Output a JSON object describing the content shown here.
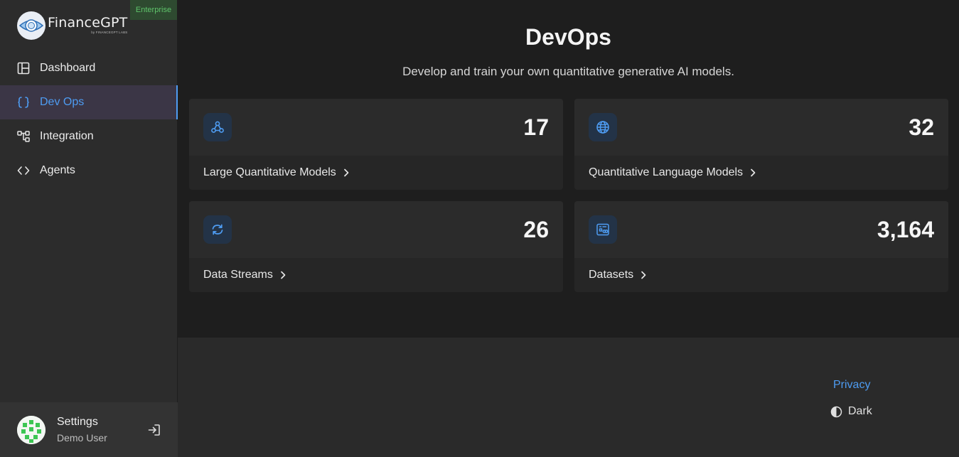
{
  "app": {
    "name": "FinanceGPT",
    "byline": "by FINANCEGPT LABS",
    "plan_badge": "Enterprise"
  },
  "sidebar": {
    "items": [
      {
        "label": "Dashboard",
        "icon": "layout-icon",
        "active": false
      },
      {
        "label": "Dev Ops",
        "icon": "braces-icon",
        "active": true
      },
      {
        "label": "Integration",
        "icon": "workflow-icon",
        "active": false
      },
      {
        "label": "Agents",
        "icon": "code-icon",
        "active": false
      }
    ]
  },
  "user": {
    "title": "Settings",
    "name": "Demo User"
  },
  "main": {
    "title": "DevOps",
    "subtitle": "Develop and train your own quantitative generative AI models.",
    "cards": [
      {
        "label": "Large Quantitative Models",
        "count": "17",
        "icon": "webhook-icon"
      },
      {
        "label": "Quantitative Language Models",
        "count": "32",
        "icon": "globe-icon"
      },
      {
        "label": "Data Streams",
        "count": "26",
        "icon": "refresh-icon"
      },
      {
        "label": "Datasets",
        "count": "3,164",
        "icon": "dataset-icon"
      }
    ]
  },
  "footer": {
    "privacy": "Privacy",
    "theme": "Dark"
  },
  "colors": {
    "accent": "#4e9cf2",
    "badge_text": "#5fc46b",
    "active_bg": "#3b3646"
  }
}
